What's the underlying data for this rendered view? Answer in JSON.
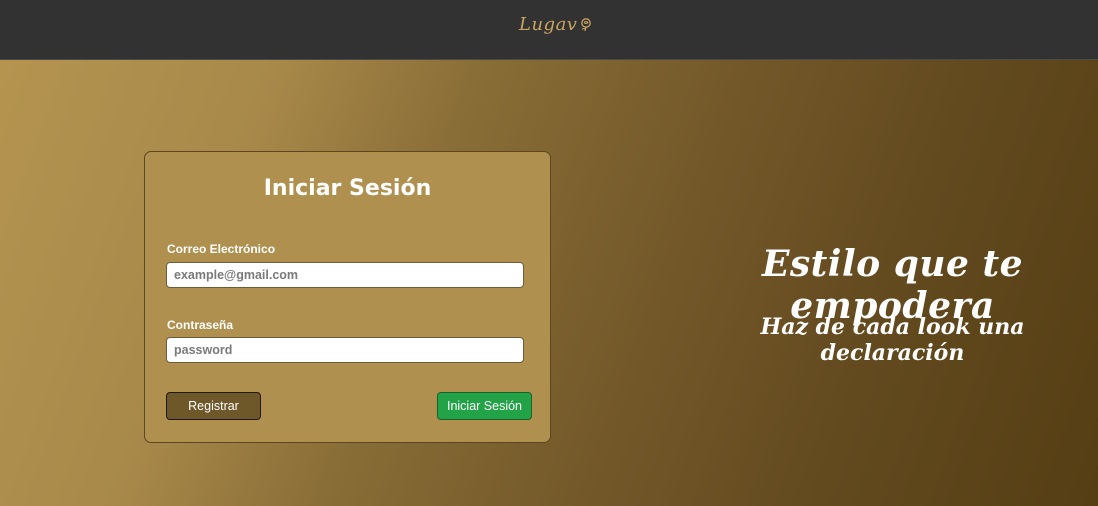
{
  "header": {
    "logo_text": "Lugav",
    "logo_icon": "rose-icon"
  },
  "login": {
    "title": "Iniciar Sesión",
    "email_label": "Correo Electrónico",
    "email_placeholder": "example@gmail.com",
    "email_value": "",
    "password_label": "Contraseña",
    "password_placeholder": "password",
    "password_value": "",
    "register_label": "Registrar",
    "login_label": "Iniciar Sesión"
  },
  "hero": {
    "headline": "Estilo que te empodera",
    "subheadline": "Haz de cada look una declaración"
  },
  "colors": {
    "topbar": "#323232",
    "accent_gold": "#c9a460",
    "card": "#b0904f",
    "register_button": "#6e5729",
    "login_button": "#23a347"
  }
}
